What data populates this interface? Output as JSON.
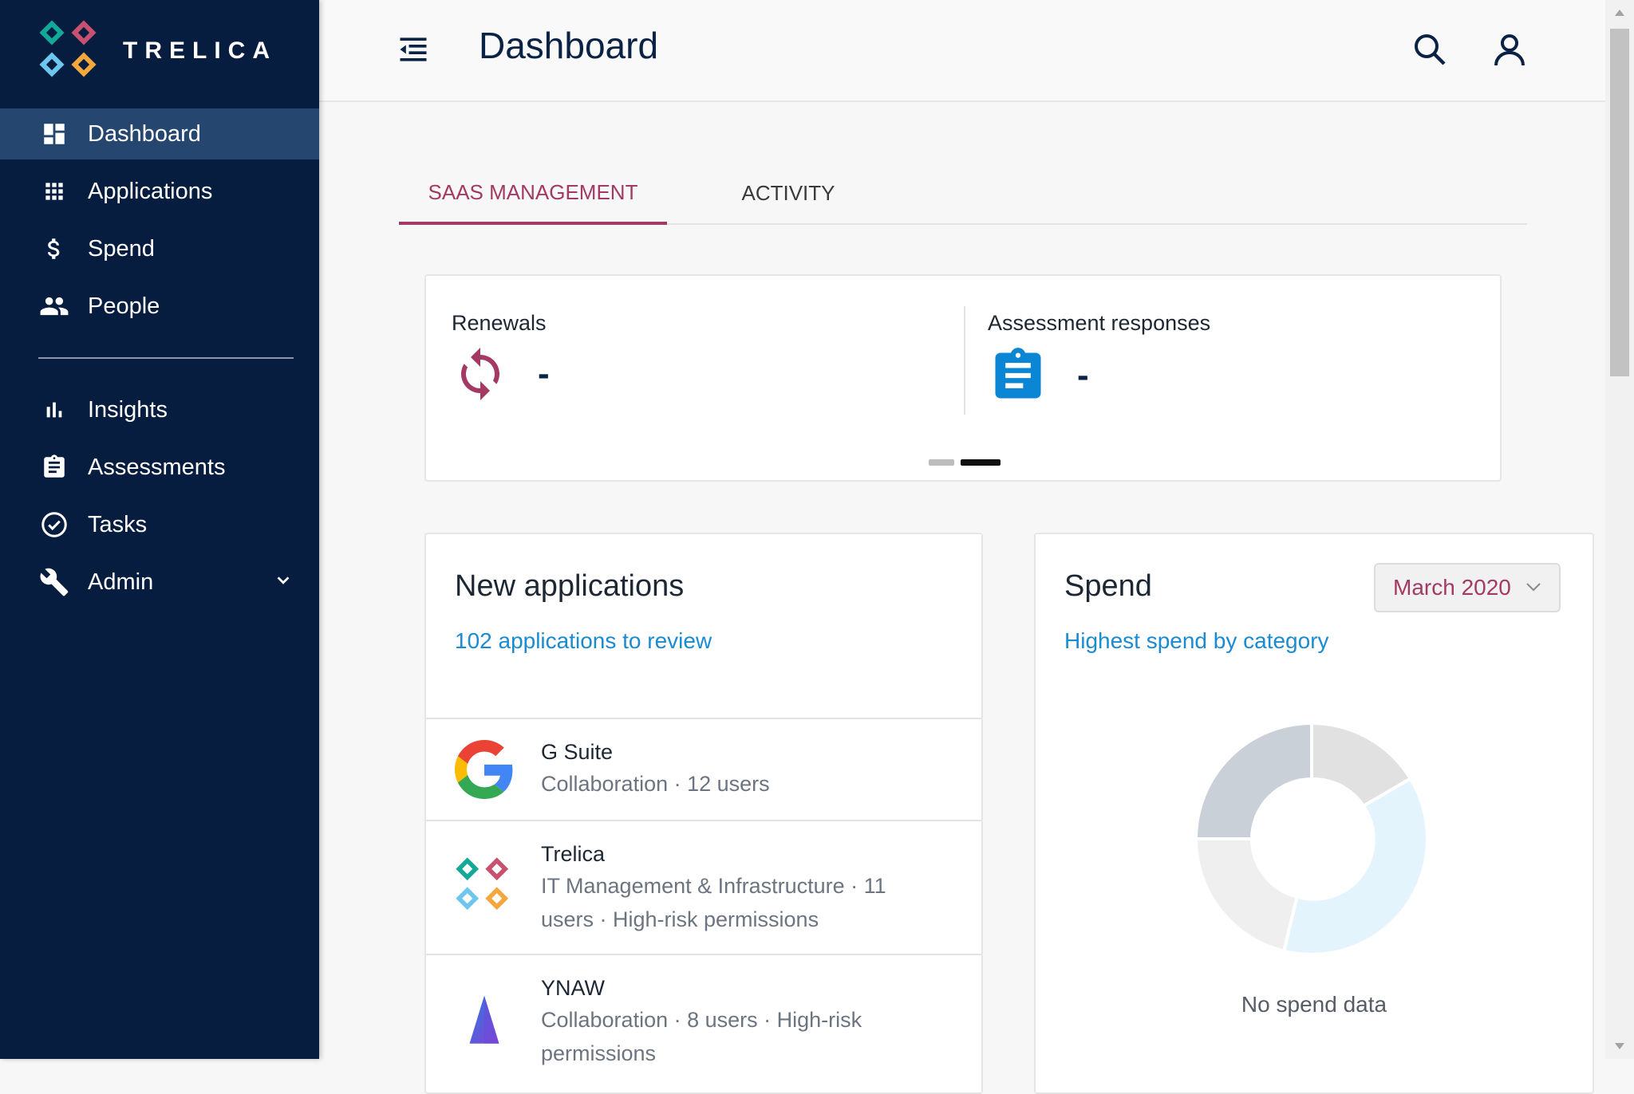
{
  "brand": {
    "name": "TRELICA"
  },
  "sidebar": {
    "items": [
      {
        "label": "Dashboard",
        "icon": "dashboard-icon",
        "active": true
      },
      {
        "label": "Applications",
        "icon": "apps-grid-icon"
      },
      {
        "label": "Spend",
        "icon": "dollar-icon"
      },
      {
        "label": "People",
        "icon": "people-icon"
      },
      {
        "label": "Insights",
        "icon": "bar-chart-icon"
      },
      {
        "label": "Assessments",
        "icon": "clipboard-icon"
      },
      {
        "label": "Tasks",
        "icon": "check-circle-icon"
      },
      {
        "label": "Admin",
        "icon": "wrench-icon",
        "expandable": true
      }
    ]
  },
  "header": {
    "title": "Dashboard"
  },
  "tabs": [
    {
      "label": "SAAS MANAGEMENT",
      "active": true
    },
    {
      "label": "ACTIVITY",
      "active": false
    }
  ],
  "metrics": [
    {
      "title": "Renewals",
      "value": "-",
      "icon": "refresh-icon"
    },
    {
      "title": "Assessment responses",
      "value": "-",
      "icon": "clipboard-icon"
    }
  ],
  "carousel": {
    "pages": 2,
    "active_page": 2
  },
  "new_applications": {
    "title": "New applications",
    "link": "102 applications to review",
    "items": [
      {
        "name": "G Suite",
        "description": "Collaboration · 12 users",
        "logo": "google-logo"
      },
      {
        "name": "Trelica",
        "description": "IT Management & Infrastructure · 11 users · High-risk permissions",
        "logo": "trelica-logo"
      },
      {
        "name": "YNAW",
        "description": "Collaboration · 8 users · High-risk permissions",
        "logo": "ynaw-logo"
      }
    ]
  },
  "spend": {
    "title": "Spend",
    "link": "Highest spend by category",
    "month": "March 2020",
    "empty_message": "No spend data"
  },
  "colors": {
    "sidebar_bg": "#071d3f",
    "sidebar_active": "#24466f",
    "accent": "#a33a63",
    "link": "#1a8bd1"
  }
}
